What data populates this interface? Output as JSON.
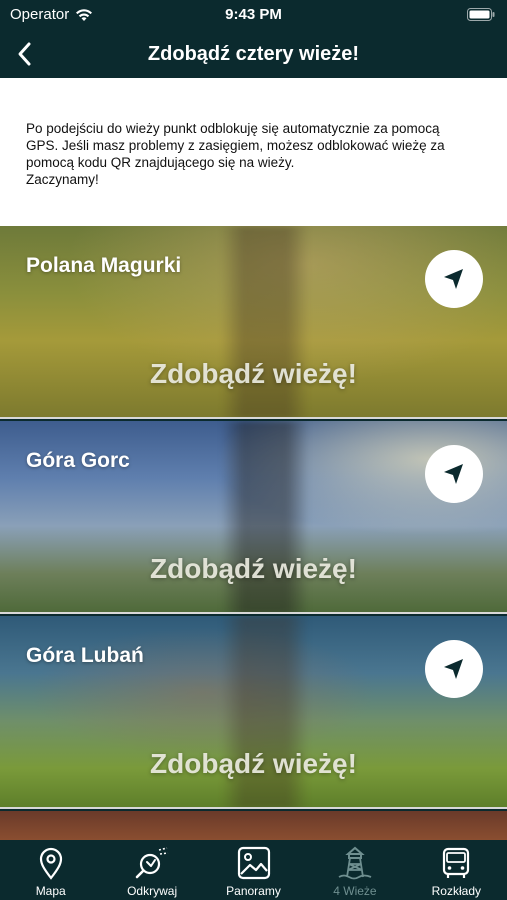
{
  "status_bar": {
    "carrier": "Operator",
    "time": "9:43 PM"
  },
  "header": {
    "title": "Zdobądź cztery wieże!"
  },
  "intro": {
    "line1": "Po podejściu do wieży punkt odblokuję się automatycznie za pomocą",
    "line2": "GPS. Jeśli masz problemy z zasięgiem, możesz odblokować wieżę za",
    "line3": "pomocą kodu QR znajdującego się na wieży.",
    "line4": "Zaczynamy!"
  },
  "towers": [
    {
      "name": "Polana Magurki",
      "cta": "Zdobądź wieżę!"
    },
    {
      "name": "Góra Gorc",
      "cta": "Zdobądź wieżę!"
    },
    {
      "name": "Góra Lubań",
      "cta": "Zdobądź wieżę!"
    }
  ],
  "tabs": [
    {
      "label": "Mapa",
      "icon": "map-pin-icon"
    },
    {
      "label": "Odkrywaj",
      "icon": "discover-icon"
    },
    {
      "label": "Panoramy",
      "icon": "image-icon"
    },
    {
      "label": "4 Wieże",
      "icon": "tower-icon",
      "active": true
    },
    {
      "label": "Rozkłady",
      "icon": "bus-icon"
    }
  ],
  "colors": {
    "bar_bg": "#0b2a2e",
    "active_tab": "#6f8f90",
    "card_border": "#d8d8d8"
  }
}
